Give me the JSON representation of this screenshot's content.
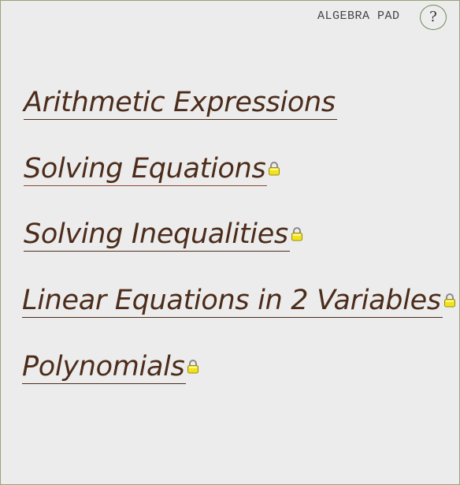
{
  "header": {
    "app_title": "ALGEBRA PAD",
    "help_label": "?"
  },
  "lessons": [
    {
      "label": "Arithmetic Expressions",
      "locked": false
    },
    {
      "label": "Solving Equations",
      "locked": true
    },
    {
      "label": "Solving Inequalities",
      "locked": true
    },
    {
      "label": "Linear Equations in 2 Variables",
      "locked": true
    },
    {
      "label": "Polynomials",
      "locked": true
    }
  ],
  "colors": {
    "background": "#ececec",
    "lesson_text": "#4c2c1a",
    "lock_body": "#f2e21c",
    "help_border": "#6f8a55"
  },
  "icons": {
    "lock": "padlock-icon"
  }
}
